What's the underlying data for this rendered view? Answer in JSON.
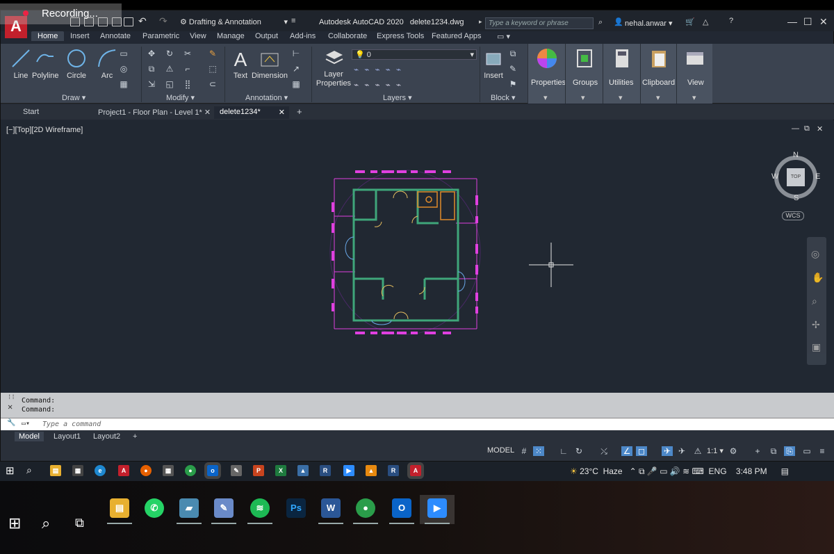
{
  "recording": {
    "label": "Recording..."
  },
  "titlebar": {
    "workspace": "Drafting & Annotation",
    "app_title": "Autodesk AutoCAD 2020",
    "file_name": "delete1234.dwg",
    "search_placeholder": "Type a keyword or phrase",
    "user": "nehal.anwar"
  },
  "ribbon_tabs": [
    "Home",
    "Insert",
    "Annotate",
    "Parametric",
    "View",
    "Manage",
    "Output",
    "Add-ins",
    "Collaborate",
    "Express Tools",
    "Featured Apps"
  ],
  "ribbon": {
    "draw": {
      "label": "Draw",
      "tools": [
        "Line",
        "Polyline",
        "Circle",
        "Arc"
      ]
    },
    "modify": {
      "label": "Modify"
    },
    "annotation": {
      "label": "Annotation",
      "tools": [
        "Text",
        "Dimension"
      ]
    },
    "layers": {
      "label": "Layers",
      "layer_properties": "Layer Properties",
      "current_layer": "0"
    },
    "block": {
      "label": "Block",
      "insert": "Insert"
    },
    "extra": [
      "Properties",
      "Groups",
      "Utilities",
      "Clipboard",
      "View"
    ]
  },
  "doc_tabs": [
    "Start",
    "Project1 - Floor Plan - Level 1*",
    "delete1234*"
  ],
  "viewport": {
    "label": "[−][Top][2D Wireframe]",
    "compass": {
      "n": "N",
      "s": "S",
      "e": "E",
      "w": "W",
      "cube": "TOP",
      "ucs": "WCS"
    }
  },
  "command": {
    "history": [
      "Command:",
      "Command:"
    ],
    "placeholder": "Type a command"
  },
  "layout_tabs": [
    "Model",
    "Layout1",
    "Layout2"
  ],
  "status": {
    "model": "MODEL",
    "scale": "1:1"
  },
  "tray": {
    "weather": "23°C",
    "condition": "Haze",
    "lang": "ENG",
    "time": "3:48 PM"
  },
  "colors": {
    "accent": "#4d88c8",
    "autocad_red": "#c3202c",
    "walls": "#3fa67a",
    "dims": "#e040e0",
    "furniture": "#e08a2a",
    "viewport_bg": "#212832"
  }
}
